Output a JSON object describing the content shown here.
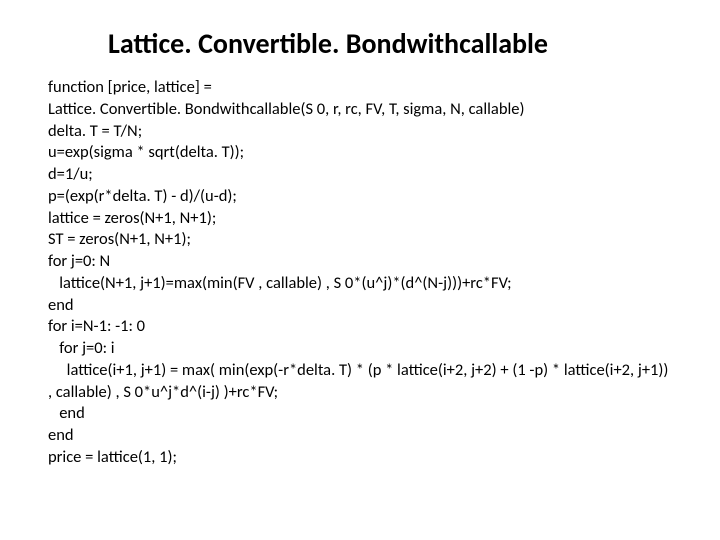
{
  "title": "Lattice. Convertible. Bondwithcallable",
  "code_lines": [
    "function [price, lattice] =",
    "Lattice. Convertible. Bondwithcallable(S 0, r, rc, FV, T, sigma, N, callable)",
    "delta. T = T/N;",
    "u=exp(sigma * sqrt(delta. T));",
    "d=1/u;",
    "p=(exp(r*delta. T) - d)/(u-d);",
    "lattice = zeros(N+1, N+1);",
    "ST = zeros(N+1, N+1);",
    "for j=0: N",
    "   lattice(N+1, j+1)=max(min(FV , callable) , S 0*(u^j)*(d^(N-j)))+rc*FV;",
    "end",
    "for i=N-1: -1: 0",
    "   for j=0: i",
    "     lattice(i+1, j+1) = max( min(exp(-r*delta. T) * (p * lattice(i+2, j+2) + (1 -p) * lattice(i+2, j+1)) , callable) , S 0*u^j*d^(i-j) )+rc*FV;",
    "   end",
    "end",
    "price = lattice(1, 1);"
  ]
}
